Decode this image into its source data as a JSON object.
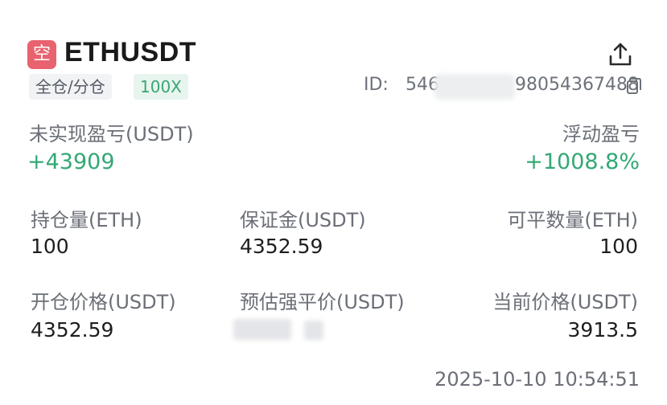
{
  "header": {
    "side_badge": "空",
    "symbol": "ETHUSDT",
    "margin_mode": "全仓/分仓",
    "leverage": "100X",
    "id_label": "ID:",
    "id_value": "546",
    "id_value_tail": "98054367488",
    "icons": [
      "share-icon",
      "copy-icon"
    ]
  },
  "pnl": {
    "unrealized_label": "未实现盈亏(USDT)",
    "unrealized_value": "+43909",
    "floating_label": "浮动盈亏",
    "floating_value": "+1008.8%"
  },
  "position": {
    "size_label": "持仓量(ETH)",
    "size_value": "100",
    "margin_label": "保证金(USDT)",
    "margin_value": "4352.59",
    "closable_label": "可平数量(ETH)",
    "closable_value": "100",
    "entry_label": "开仓价格(USDT)",
    "entry_value": "4352.59",
    "liq_label": "预估强平价(USDT)",
    "mark_label": "当前价格(USDT)",
    "mark_value": "3913.5"
  },
  "timestamp": "2025-10-10 10:54:51",
  "colors": {
    "profit_green": "#33a874",
    "short_badge": "#e8636f",
    "leverage_bg": "#e7f5ee"
  }
}
